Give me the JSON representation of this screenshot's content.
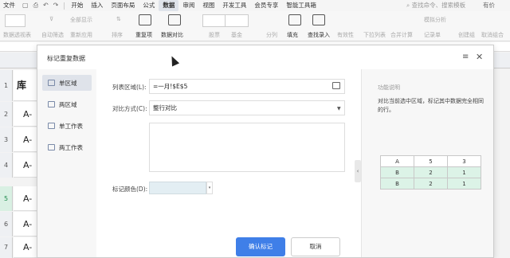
{
  "menubar": {
    "file": "文件",
    "tabs": [
      {
        "label": "开始",
        "active": false
      },
      {
        "label": "插入",
        "active": false
      },
      {
        "label": "页面布局",
        "active": false
      },
      {
        "label": "公式",
        "active": false
      },
      {
        "label": "数据",
        "active": true
      },
      {
        "label": "审阅",
        "active": false
      },
      {
        "label": "视图",
        "active": false
      },
      {
        "label": "开发工具",
        "active": false
      },
      {
        "label": "会员专享",
        "active": false
      },
      {
        "label": "智能工具箱",
        "active": false
      }
    ],
    "search": "查找命令、搜索模板",
    "right": "有价"
  },
  "ribbon": {
    "pivot": "数据透视表",
    "autofilter": "自动筛选",
    "show_all": "全部显示",
    "reapply": "重新应用",
    "sort": "排序",
    "duplicates": "重复项",
    "compare": "数据对比",
    "stock": "股票",
    "fund": "基金",
    "split": "分列",
    "fill": "填充",
    "find_entry": "查找录入",
    "validity": "有效性",
    "dropdown_list": "下拉列表",
    "consolidate": "合并计算",
    "simulation": "模拟分析",
    "record_sheet": "记录单",
    "create_group": "创建组",
    "ungroup": "取消组合"
  },
  "sheet": {
    "rows": [
      {
        "num": "1",
        "text": "库房-",
        "header": true
      },
      {
        "num": "2",
        "text": "A-0",
        "header": false
      },
      {
        "num": "3",
        "text": "A-0",
        "header": false
      },
      {
        "num": "4",
        "text": "A-0",
        "header": false
      },
      {
        "num": "5",
        "text": "A-0",
        "header": false
      },
      {
        "num": "6",
        "text": "A-0",
        "header": false
      },
      {
        "num": "7",
        "text": "A-0",
        "header": false
      }
    ],
    "selected_row": "5"
  },
  "dialog": {
    "title": "标记重复数据",
    "nav": [
      {
        "label": "单区域",
        "active": true
      },
      {
        "label": "两区域",
        "active": false
      },
      {
        "label": "单工作表",
        "active": false
      },
      {
        "label": "两工作表",
        "active": false
      }
    ],
    "range_label": "列表区域(L):",
    "range_value": "=一月!$E$5",
    "compare_label": "对比方式(C):",
    "compare_value": "整行对比",
    "color_label": "标记颜色(D):",
    "mark_color": "#e3eef3",
    "confirm": "确认标记",
    "cancel": "取消",
    "info_title": "功能说明",
    "info_desc": "对比当前选中区域，标记其中数据完全相同的行。",
    "example_rows": [
      {
        "cells": [
          "A",
          "5",
          "3"
        ],
        "highlight": false
      },
      {
        "cells": [
          "B",
          "2",
          "1"
        ],
        "highlight": true
      },
      {
        "cells": [
          "B",
          "2",
          "1"
        ],
        "highlight": true
      }
    ]
  },
  "colors": {
    "accent": "#3f7fe8",
    "duplicate_highlight": "#dcf3e7",
    "selected_row": "#d9f0e3"
  }
}
